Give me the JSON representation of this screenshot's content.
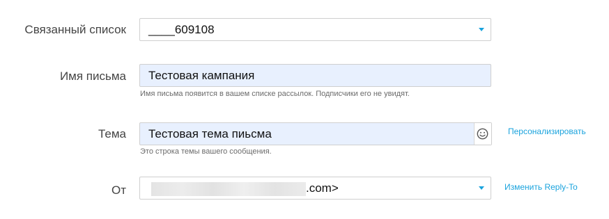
{
  "form": {
    "list": {
      "label": "Связанный список",
      "value": "____609108"
    },
    "email_name": {
      "label": "Имя письма",
      "value": "Тестовая кампания",
      "hint": "Имя письма появится в вашем списке рассылок. Подписчики его не увидят."
    },
    "subject": {
      "label": "Тема",
      "value": "Тестовая тема пиьсма",
      "hint": "Это строка темы вашего сообщения.",
      "personalize_link": "Персонализировать"
    },
    "from": {
      "label": "От",
      "value_suffix": ".com>",
      "reply_to_link": "Изменить Reply-To"
    }
  },
  "colors": {
    "accent": "#1aa3dd",
    "filled_bg": "#e8f0fe",
    "label": "#444444"
  },
  "icons": {
    "dropdown": "chevron-down-icon",
    "emoji": "smiley-icon"
  }
}
